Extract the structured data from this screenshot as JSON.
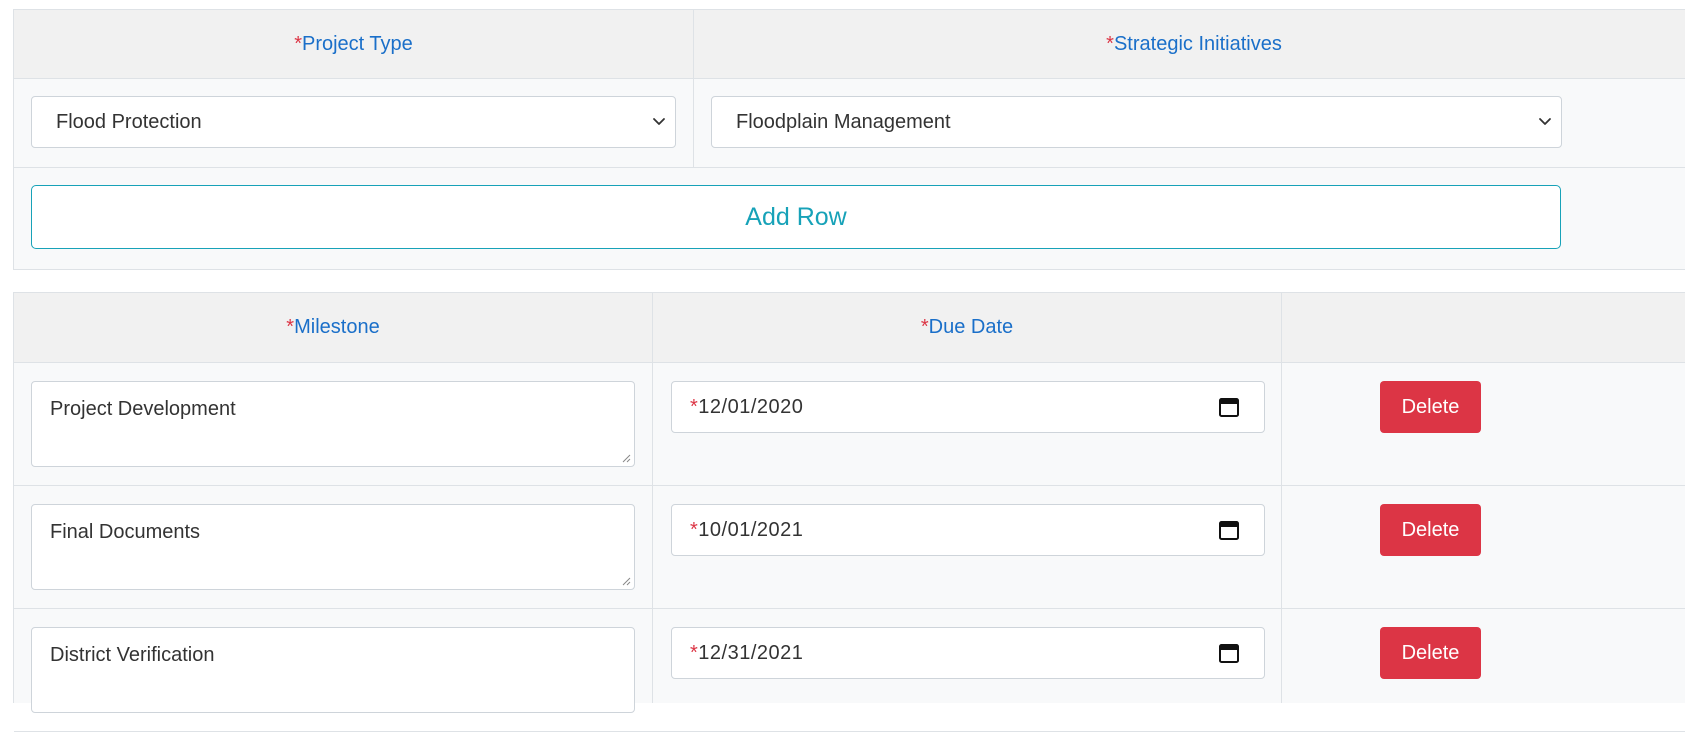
{
  "project_table": {
    "headers": {
      "required_mark": "*",
      "project_type": "Project Type",
      "strategic_initiatives": "Strategic Initiatives"
    },
    "project_type_value": "Flood Protection",
    "strategic_initiatives_value": "Floodplain Management",
    "add_row_label": "Add Row"
  },
  "milestone_table": {
    "headers": {
      "required_mark": "*",
      "milestone": "Milestone",
      "due_date": "Due Date"
    },
    "rows": [
      {
        "milestone": "Project Development",
        "due_date": "12/01/2020",
        "delete_label": "Delete"
      },
      {
        "milestone": "Final Documents",
        "due_date": "10/01/2021",
        "delete_label": "Delete"
      },
      {
        "milestone": "District Verification",
        "due_date": "12/31/2021",
        "delete_label": "Delete"
      }
    ]
  },
  "colors": {
    "required_asterisk": "#dc3545",
    "header_text": "#1a6fc9",
    "add_row_outline": "#17a2b8",
    "delete_button": "#dc3545"
  },
  "icons": {
    "select_arrow": "chevron-down-icon",
    "date_picker": "calendar-icon",
    "textarea_resize": "resize-grip-icon"
  }
}
